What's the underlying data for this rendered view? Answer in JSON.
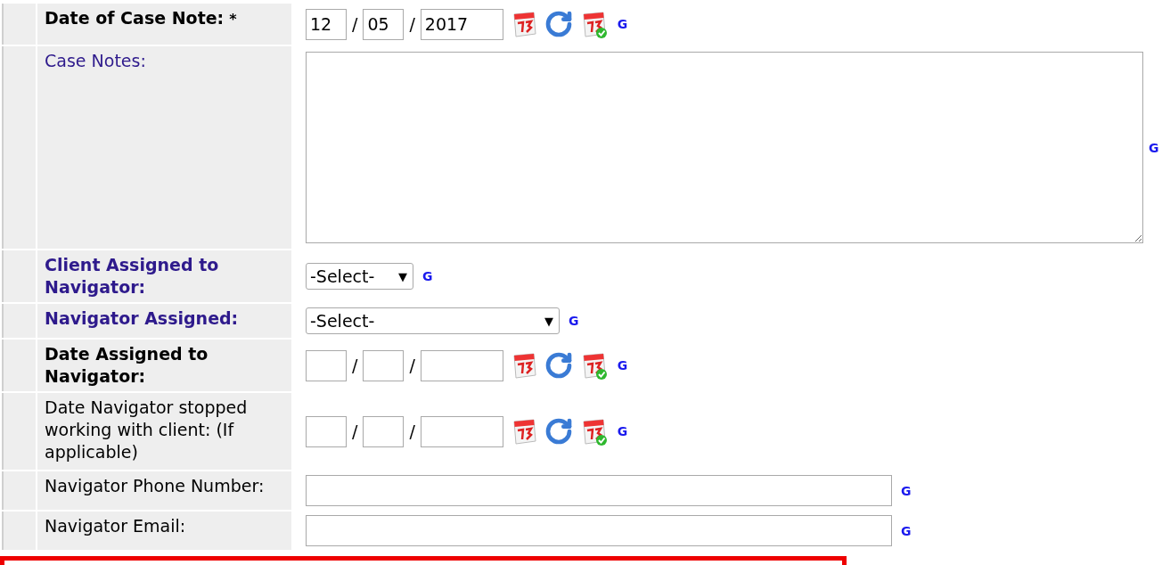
{
  "rows": [
    {
      "kind": "date",
      "label": "Date of Case Note:",
      "bold": true,
      "color": "#000000",
      "required_mark": "*",
      "day": "12",
      "month": "05",
      "year": "2017",
      "separator": "/",
      "link": "G"
    },
    {
      "kind": "textarea",
      "label": "Case Notes:",
      "bold": false,
      "color": "#2e1a8c",
      "link": "G"
    },
    {
      "kind": "select",
      "label": "Client Assigned to Navigator:",
      "bold": true,
      "color": "#2e1a8c",
      "value": "-Select-",
      "arrow": "▼",
      "wide": false,
      "link": "G"
    },
    {
      "kind": "select",
      "label": "Navigator Assigned:",
      "bold": true,
      "color": "#2e1a8c",
      "value": "-Select-",
      "arrow": "▼",
      "wide": true,
      "link": "G"
    },
    {
      "kind": "date",
      "label": "Date Assigned to Navigator:",
      "bold": true,
      "color": "#000000",
      "separator": "/",
      "link": "G"
    },
    {
      "kind": "date",
      "label": "Date Navigator stopped working with client: (If applicable)",
      "bold": false,
      "color": "#000000",
      "separator": "/",
      "link": "G"
    },
    {
      "kind": "text",
      "label": "Navigator Phone Number:",
      "bold": false,
      "color": "#000000",
      "link": "G"
    },
    {
      "kind": "text",
      "label": "Navigator Email:",
      "bold": false,
      "color": "#000000",
      "link": "G"
    }
  ]
}
